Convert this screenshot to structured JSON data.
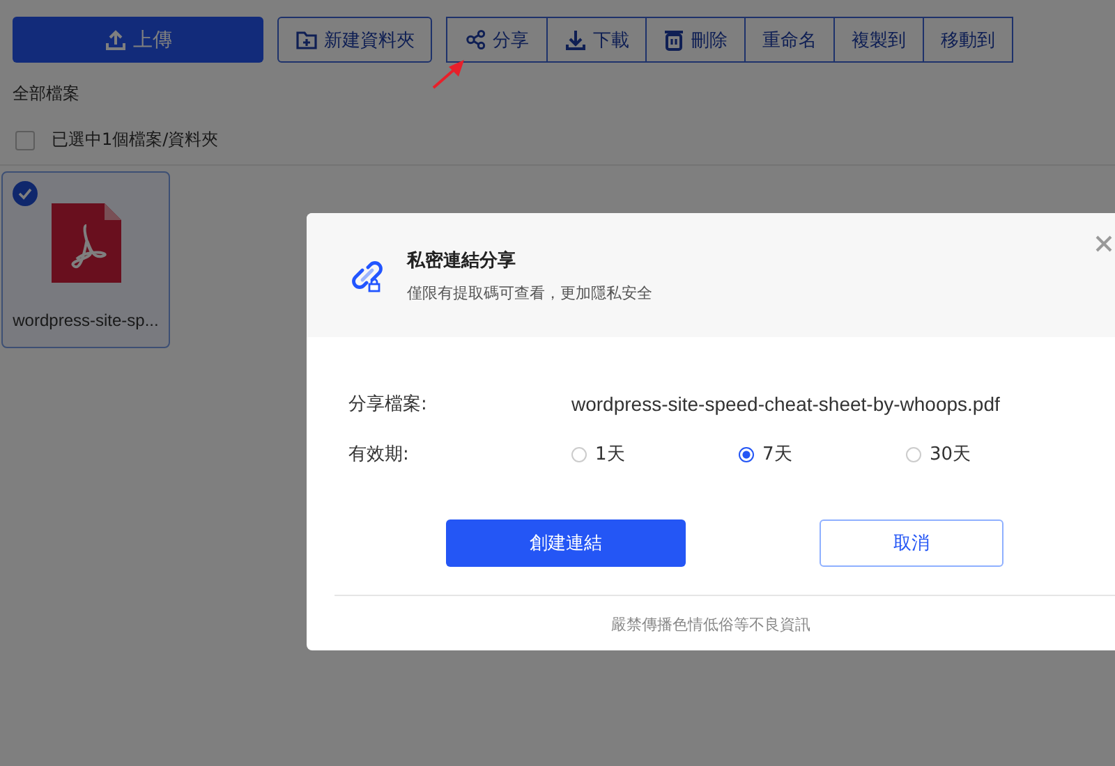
{
  "toolbar": {
    "upload": {
      "label": "上傳"
    },
    "new_folder": {
      "label": "新建資料夾"
    },
    "actions": [
      {
        "kind": "share",
        "label": "分享"
      },
      {
        "kind": "download",
        "label": "下載"
      },
      {
        "kind": "delete",
        "label": "刪除"
      },
      {
        "kind": "text",
        "label": "重命名"
      },
      {
        "kind": "text",
        "label": "複製到"
      },
      {
        "kind": "text",
        "label": "移動到"
      }
    ]
  },
  "breadcrumb": "全部檔案",
  "selection": {
    "label": "已選中1個檔案/資料夾",
    "checked": false
  },
  "files": [
    {
      "kind": "pdf",
      "name": "wordpress-site-sp...",
      "selected": true
    }
  ],
  "dialog": {
    "title": "私密連結分享",
    "subtitle": "僅限有提取碼可查看，更加隱私安全",
    "file_label": "分享檔案:",
    "file_value": "wordpress-site-speed-cheat-sheet-by-whoops.pdf",
    "validity_label": "有效期:",
    "validity_options": [
      {
        "label": "1天",
        "selected": false
      },
      {
        "label": "7天",
        "selected": true
      },
      {
        "label": "30天",
        "selected": false
      }
    ],
    "create_button": "創建連結",
    "cancel_button": "取消",
    "footer_note": "嚴禁傳播色情低俗等不良資訊"
  }
}
